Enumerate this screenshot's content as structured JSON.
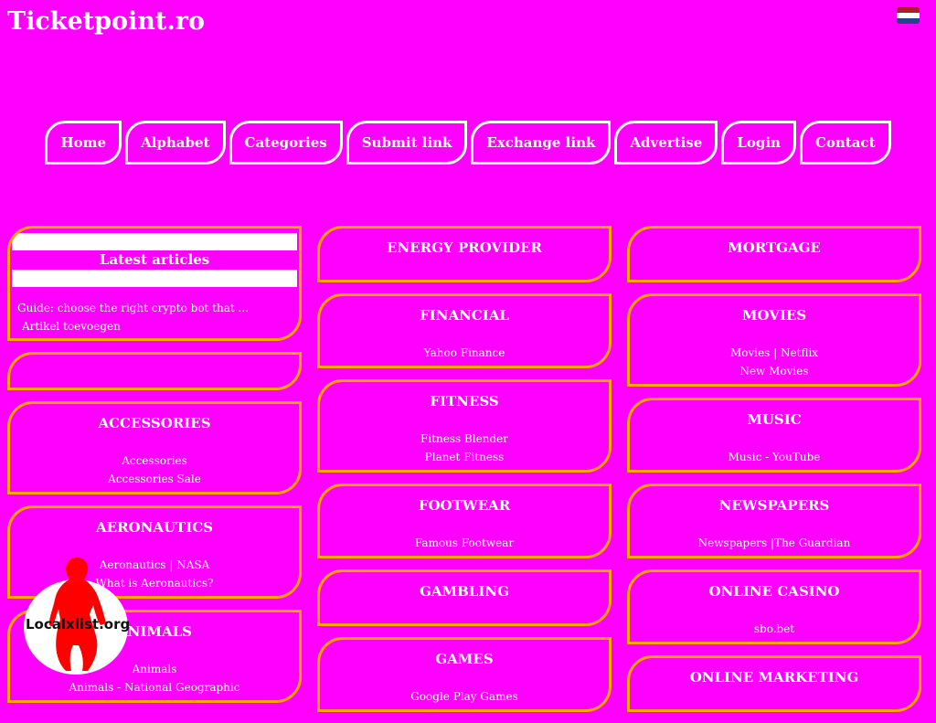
{
  "header": {
    "title": "Ticketpoint.ro",
    "flag": {
      "icon": "netherlands-flag-icon",
      "colors": [
        "#ae1c28",
        "#ffffff",
        "#21468b"
      ]
    }
  },
  "nav": [
    "Home",
    "Alphabet",
    "Categories",
    "Submit link",
    "Exchange link",
    "Advertise",
    "Login",
    "Contact"
  ],
  "sidebar": {
    "latest_title": "Latest articles",
    "latest_items": [
      "Guide: choose the right crypto bot that ...",
      "Artikel toevoegen"
    ]
  },
  "columns": [
    [
      {
        "title": "ACCESSORIES",
        "links": [
          "Accessories",
          "Accessories Sale"
        ]
      },
      {
        "title": "AERONAUTICS",
        "links": [
          "Aeronautics | NASA",
          "What is Aeronautics?"
        ]
      },
      {
        "title": "ANIMALS",
        "links": [
          "Animals",
          "Animals - National Geographic"
        ]
      }
    ],
    [
      {
        "title": "ENERGY PROVIDER",
        "links": []
      },
      {
        "title": "FINANCIAL",
        "links": [
          "Yahoo Finance"
        ]
      },
      {
        "title": "FITNESS",
        "links": [
          "Fitness Blender",
          "Planet Fitness"
        ]
      },
      {
        "title": "FOOTWEAR",
        "links": [
          "Famous Footwear"
        ]
      },
      {
        "title": "GAMBLING",
        "links": []
      },
      {
        "title": "GAMES",
        "links": [
          "Google Play Games"
        ]
      }
    ],
    [
      {
        "title": "MORTGAGE",
        "links": []
      },
      {
        "title": "MOVIES",
        "links": [
          "Movies | Netflix",
          "New Movies"
        ]
      },
      {
        "title": "MUSIC",
        "links": [
          "Music - YouTube"
        ]
      },
      {
        "title": "NEWSPAPERS",
        "links": [
          "Newspapers |The Guardian"
        ]
      },
      {
        "title": "ONLINE CASINO",
        "links": [
          "sbo.bet"
        ]
      },
      {
        "title": "ONLINE MARKETING",
        "links": []
      }
    ]
  ],
  "watermark": {
    "text": "Localxlist.org",
    "figure_color": "#ff0000"
  },
  "colors": {
    "background": "#ff00ff",
    "box_border": "#ffa500",
    "text": "#ffffff"
  }
}
